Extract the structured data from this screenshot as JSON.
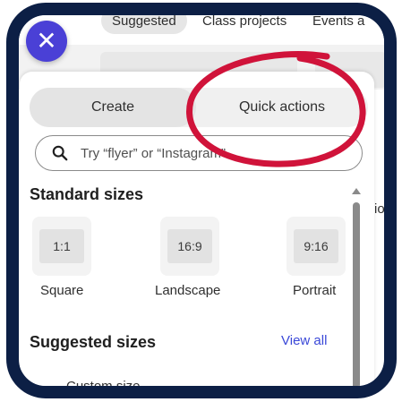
{
  "tabs": [
    {
      "label": "Suggested",
      "active": true
    },
    {
      "label": "Class projects",
      "active": false
    },
    {
      "label": "Events a",
      "active": false
    }
  ],
  "background_partial_text": "io",
  "close_button": {
    "glyph": "✕"
  },
  "segmented": {
    "create": "Create",
    "quick_actions": "Quick actions"
  },
  "search": {
    "placeholder": "Try “flyer” or “Instagram”"
  },
  "standard_sizes": {
    "title": "Standard sizes",
    "items": [
      {
        "ratio": "1:1",
        "label": "Square"
      },
      {
        "ratio": "16:9",
        "label": "Landscape"
      },
      {
        "ratio": "9:16",
        "label": "Portrait"
      }
    ]
  },
  "suggested_sizes": {
    "title": "Suggested sizes",
    "view_all": "View all",
    "first_item": "Custom size"
  },
  "colors": {
    "frame": "#0c1f45",
    "close_button": "#4a40d6",
    "link": "#3a48d8",
    "annotation": "#d0133a"
  },
  "icons": {
    "search": "search-icon",
    "close": "close-icon"
  }
}
